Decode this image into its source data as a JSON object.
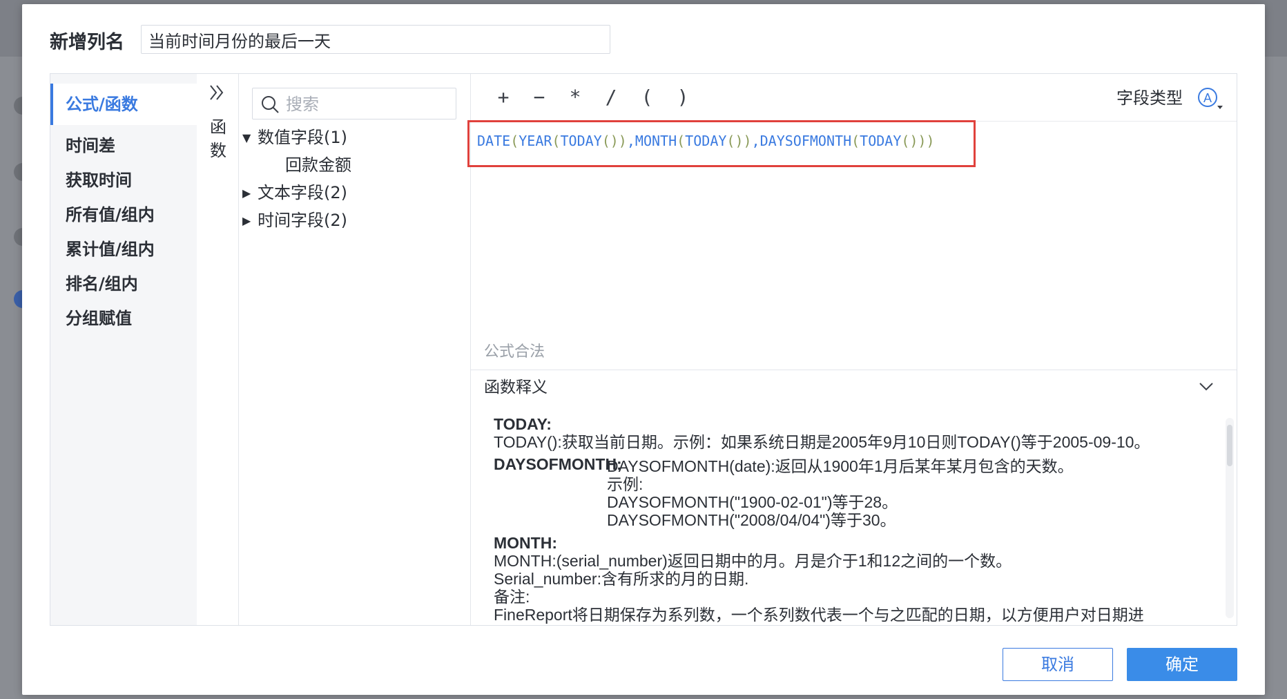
{
  "dialog": {
    "title": "新增列名",
    "name_value": "当前时间月份的最后一天"
  },
  "categories": [
    {
      "label": "公式/函数",
      "active": true
    },
    {
      "label": "时间差",
      "active": false
    },
    {
      "label": "获取时间",
      "active": false
    },
    {
      "label": "所有值/组内",
      "active": false
    },
    {
      "label": "累计值/组内",
      "active": false
    },
    {
      "label": "排名/组内",
      "active": false
    },
    {
      "label": "分组赋值",
      "active": false
    }
  ],
  "collapse": {
    "vertical_label_1": "函",
    "vertical_label_2": "数"
  },
  "field_panel": {
    "search_placeholder": "搜索",
    "groups": [
      {
        "label": "数值字段(1)",
        "expanded": true,
        "children": [
          "回款金额"
        ]
      },
      {
        "label": "文本字段(2)",
        "expanded": false
      },
      {
        "label": "时间字段(2)",
        "expanded": false
      }
    ]
  },
  "toolbar": {
    "ops": [
      "+",
      "−",
      "*",
      "/",
      "(",
      ")"
    ],
    "field_type_label": "字段类型"
  },
  "formula": {
    "text": "DATE(YEAR(TODAY()),MONTH(TODAY()),DAYSOFMONTH(TODAY()))",
    "status": "公式合法"
  },
  "description": {
    "title": "函数释义",
    "today_name": "TODAY:",
    "today_text": "TODAY():获取当前日期。示例：如果系统日期是2005年9月10日则TODAY()等于2005-09-10。",
    "daysofmonth_name": "DAYSOFMONTH:",
    "daysofmonth_text": "DAYSOFMONTH(date):返回从1900年1月后某年某月包含的天数。",
    "daysofmonth_example_label": "示例:",
    "daysofmonth_example_1": "DAYSOFMONTH(\"1900-02-01\")等于28。",
    "daysofmonth_example_2": "DAYSOFMONTH(\"2008/04/04\")等于30。",
    "month_name": "MONTH:",
    "month_text": "MONTH:(serial_number)返回日期中的月。月是介于1和12之间的一个数。",
    "month_serial": "Serial_number:含有所求的月的日期.",
    "month_note": "备注:",
    "month_cutoff": "FineReport将日期保存为系列数，一个系列数代表一个与之匹配的日期，以方便用户对日期进"
  },
  "footer": {
    "cancel_label": "取消",
    "ok_label": "确定"
  },
  "colors": {
    "accent": "#3a7ae0",
    "highlight": "#e0413c"
  }
}
